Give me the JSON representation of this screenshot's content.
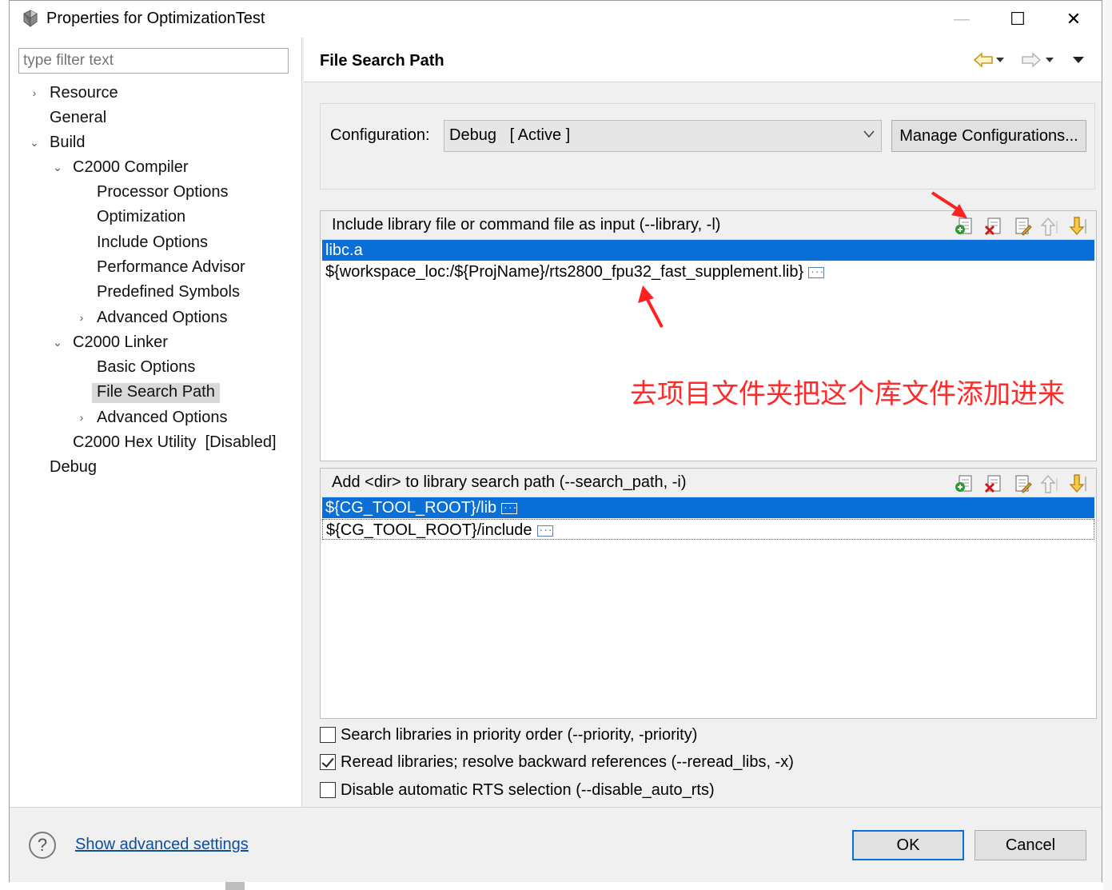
{
  "window": {
    "title": "Properties for OptimizationTest",
    "minimize_glyph": "—",
    "maximize_glyph": "☐",
    "close_glyph": "✕"
  },
  "filter": {
    "placeholder": "type filter text"
  },
  "tree": {
    "items": [
      {
        "label": "Resource",
        "arrow": "›"
      },
      {
        "label": "General"
      },
      {
        "label": "Build",
        "arrow": "⌄"
      },
      {
        "label": "C2000 Compiler",
        "arrow": "⌄"
      },
      {
        "label": "Processor Options"
      },
      {
        "label": "Optimization"
      },
      {
        "label": "Include Options"
      },
      {
        "label": "Performance Advisor"
      },
      {
        "label": "Predefined Symbols"
      },
      {
        "label": "Advanced Options",
        "arrow": "›"
      },
      {
        "label": "C2000 Linker",
        "arrow": "⌄"
      },
      {
        "label": "Basic Options"
      },
      {
        "label": "File Search Path",
        "selected": true
      },
      {
        "label": "Advanced Options",
        "arrow": "›"
      },
      {
        "label": "C2000 Hex Utility  [Disabled]"
      },
      {
        "label": "Debug"
      }
    ]
  },
  "page": {
    "title": "File Search Path"
  },
  "configuration": {
    "label": "Configuration:",
    "selected": "Debug   [ Active ]",
    "manage_label": "Manage Configurations..."
  },
  "library_group": {
    "title": "Include library file or command file as input (--library, -l)",
    "rows": [
      "libc.a",
      "${workspace_loc:/${ProjName}/rts2800_fpu32_fast_supplement.lib}"
    ]
  },
  "annotation": {
    "text": "去项目文件夹把这个库文件添加进来",
    "color": "#ff2a2a"
  },
  "search_path_group": {
    "title": "Add <dir> to library search path (--search_path, -i)",
    "rows": [
      "${CG_TOOL_ROOT}/lib",
      "${CG_TOOL_ROOT}/include"
    ]
  },
  "options": {
    "priority": "Search libraries in priority order (--priority, -priority)",
    "reread": "Reread libraries; resolve backward references (--reread_libs, -x)",
    "disable_rts": "Disable automatic RTS selection (--disable_auto_rts)"
  },
  "footer": {
    "help_glyph": "?",
    "advanced_link": "Show advanced settings",
    "ok_label": "OK",
    "cancel_label": "Cancel"
  },
  "colors": {
    "selection": "#0a6fd7",
    "link": "#0b4ea2",
    "annotation_red": "#ff2a2a"
  }
}
